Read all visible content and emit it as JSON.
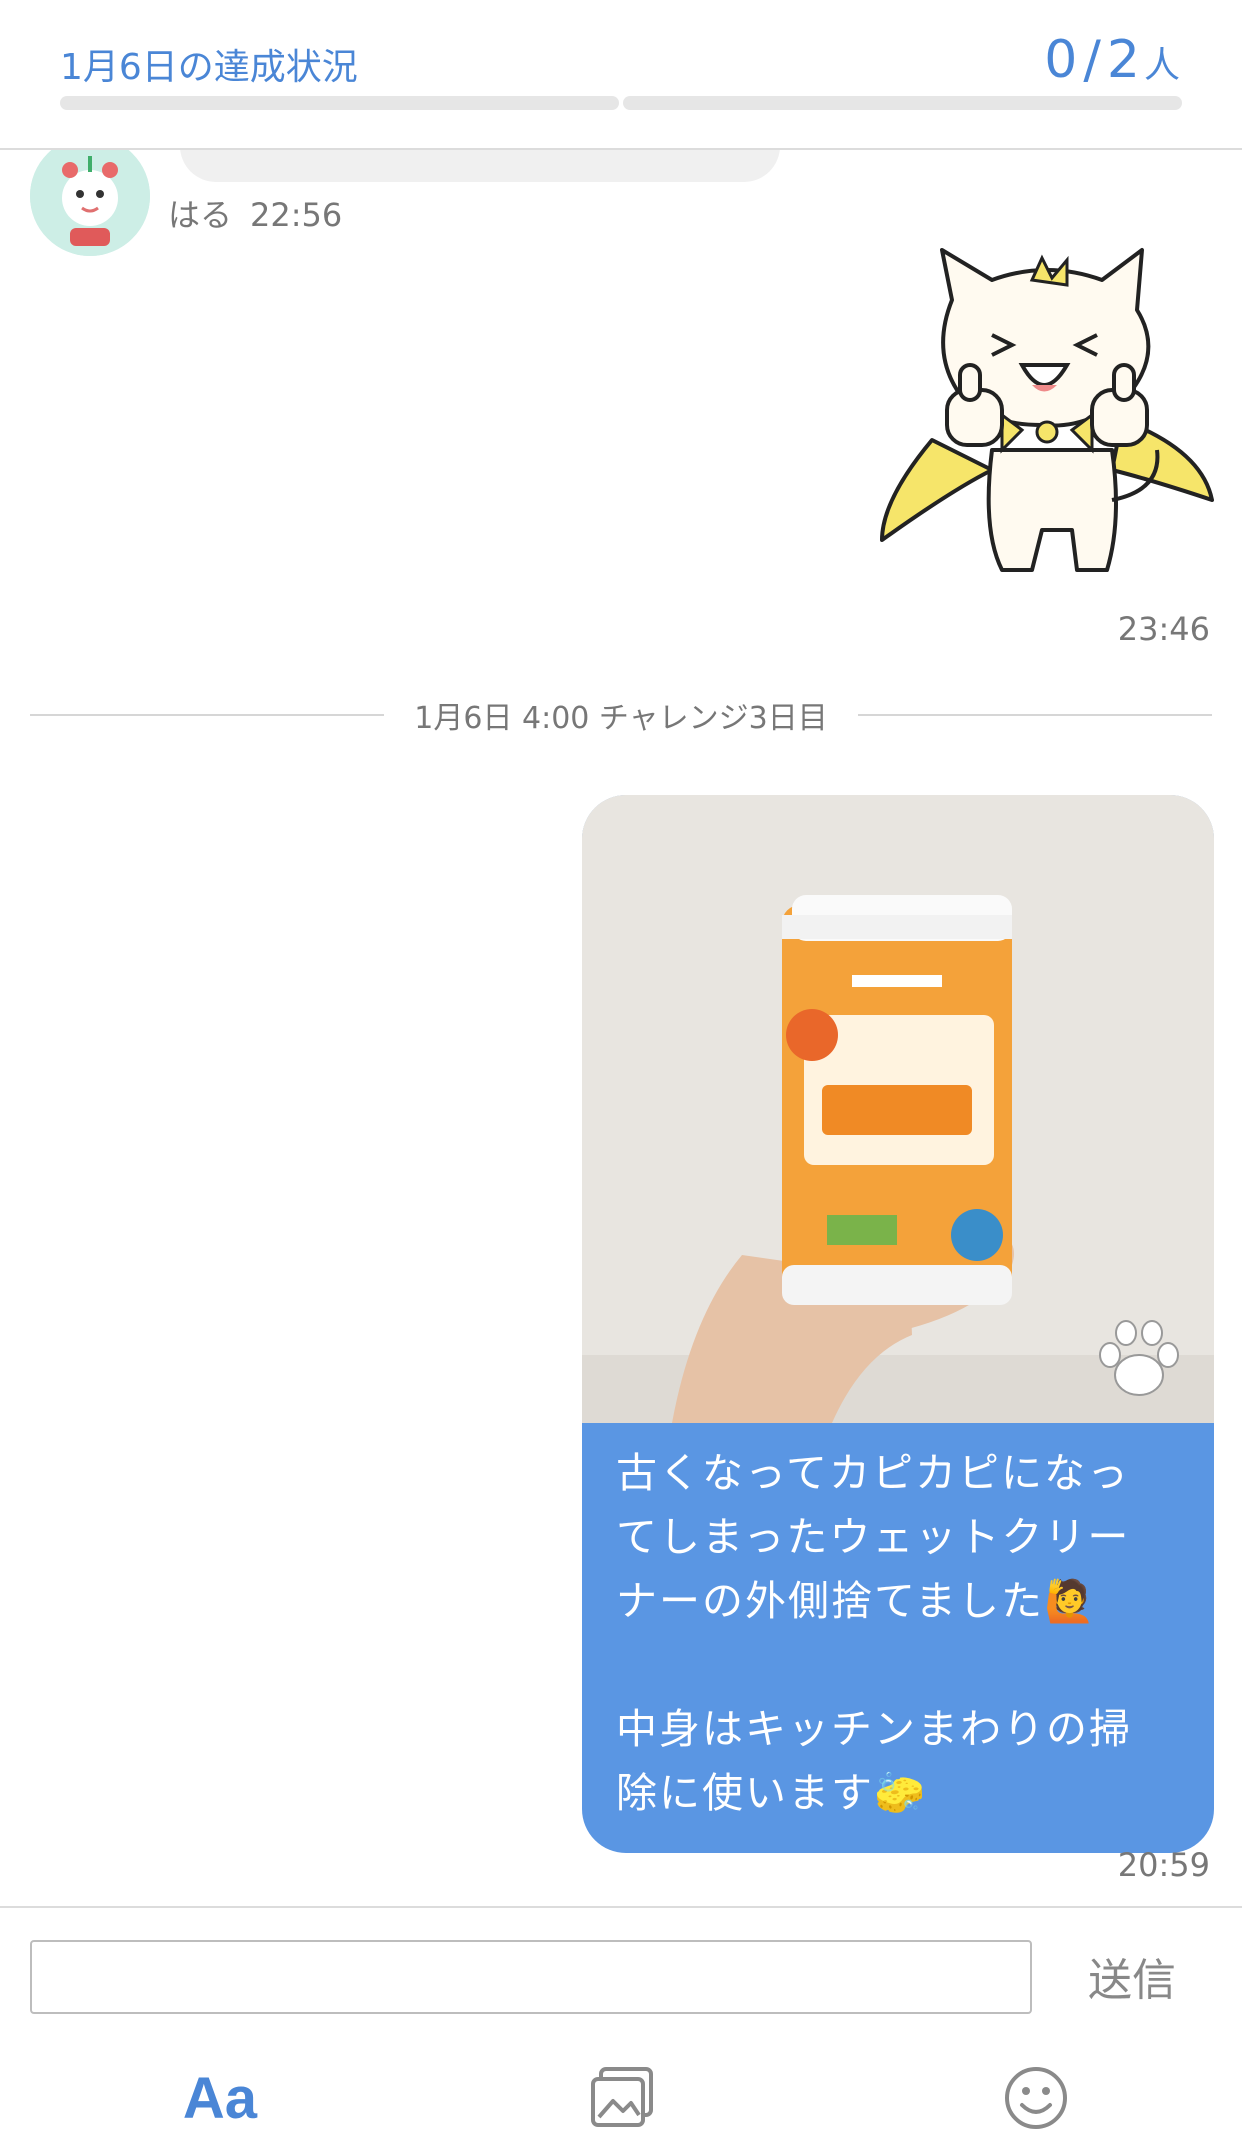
{
  "header": {
    "title": "1月6日の達成状況",
    "count_done": "0",
    "count_sep": "/",
    "count_total": "2",
    "count_unit": "人",
    "progress_segments": 2,
    "progress_completed": 0
  },
  "messages": {
    "prev": {
      "sender": "はる",
      "time": "22:56"
    },
    "sticker": {
      "icon": "cat-hero-sticker",
      "time": "23:46"
    },
    "divider": "1月6日 4:00 チャレンジ3日目",
    "post": {
      "photo_icon": "cleaner-container-photo",
      "paw_icon": "paw-icon",
      "text_lines": [
        "古くなってカピカピになっ",
        "てしまったウェットクリー",
        "ナーの外側捨てました🙋",
        "",
        "中身はキッチンまわりの掃",
        "除に使います🧽"
      ],
      "time": "20:59"
    }
  },
  "input": {
    "value": "",
    "send_label": "送信",
    "aa_label": "Aa",
    "image_icon": "image-icon",
    "emoji_icon": "smiley-icon"
  },
  "colors": {
    "accent": "#4a86d6",
    "bubble": "#5a96e3"
  }
}
